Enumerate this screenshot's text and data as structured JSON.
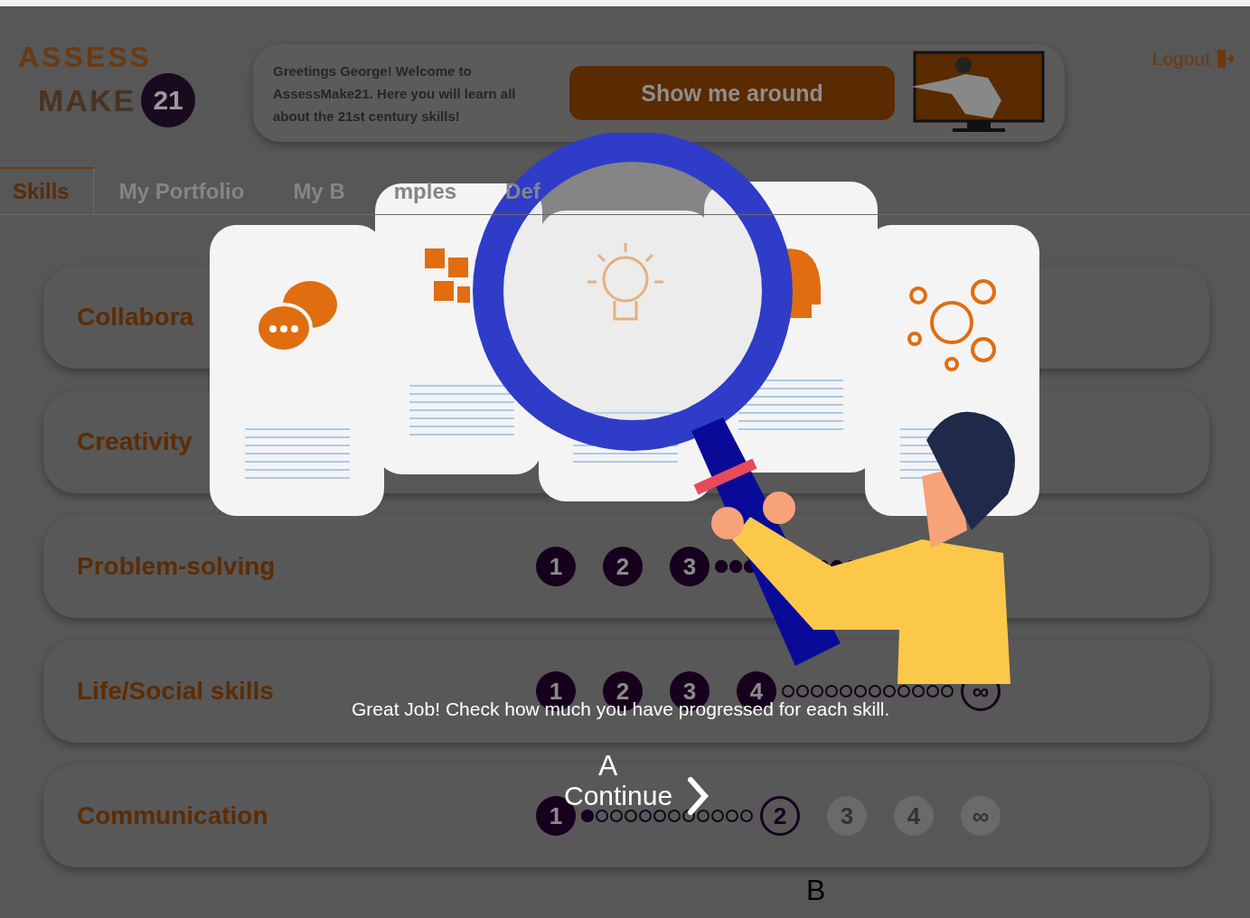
{
  "logo": {
    "line1": "ASSESS",
    "line2": "MAKE",
    "badge": "21"
  },
  "greeting": {
    "text": "Greetings George! Welcome to AssessMake21. Here you will learn all about the 21st century skills!",
    "button": "Show me around"
  },
  "logout": "Logout",
  "tabs": [
    {
      "label": "Skills",
      "selected": true
    },
    {
      "label": "My Portfolio",
      "selected": false
    },
    {
      "label": "My B",
      "selected": false
    },
    {
      "label": "mples",
      "selected": false
    },
    {
      "label": "Def",
      "selected": false
    }
  ],
  "skills": [
    {
      "name": "Collabora"
    },
    {
      "name": "Creativity"
    },
    {
      "name": "Problem-solving",
      "items": [
        {
          "kind": "step",
          "label": "1",
          "done": true,
          "disabled": false
        },
        {
          "kind": "step",
          "label": "2",
          "done": true,
          "disabled": false
        },
        {
          "kind": "step",
          "label": "3",
          "done": true,
          "disabled": false
        },
        {
          "kind": "trail",
          "level": 1
        }
      ]
    },
    {
      "name": "Life/Social skills",
      "items": [
        {
          "kind": "step",
          "label": "1",
          "done": true,
          "disabled": false
        },
        {
          "kind": "step",
          "label": "2",
          "done": true,
          "disabled": false
        },
        {
          "kind": "step",
          "label": "3",
          "done": true,
          "disabled": false
        },
        {
          "kind": "step",
          "label": "4",
          "done": true,
          "disabled": false
        },
        {
          "kind": "trail"
        },
        {
          "kind": "step",
          "label": "∞",
          "done": false,
          "disabled": false
        }
      ]
    },
    {
      "name": "Communication",
      "items": [
        {
          "kind": "step",
          "label": "1",
          "done": true,
          "disabled": false
        },
        {
          "kind": "trail",
          "level": 0.1
        },
        {
          "kind": "step",
          "label": "2",
          "done": false,
          "disabled": false
        },
        {
          "kind": "step",
          "label": "3",
          "done": false,
          "disabled": true
        },
        {
          "kind": "step",
          "label": "4",
          "done": false,
          "disabled": true
        },
        {
          "kind": "step",
          "label": "∞",
          "done": false,
          "disabled": true
        }
      ]
    }
  ],
  "overlay": {
    "message": "Great Job! Check how much you have progressed for each skill.",
    "marker_a": "A",
    "continue": "Continue",
    "marker_b": "B"
  }
}
